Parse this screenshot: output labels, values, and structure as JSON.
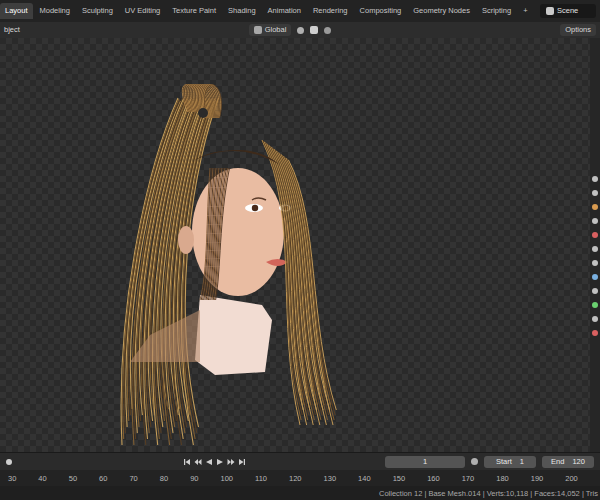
{
  "top_bar": {
    "tabs": [
      {
        "label": "Layout",
        "selected": true
      },
      {
        "label": "Modeling",
        "selected": false
      },
      {
        "label": "Sculpting",
        "selected": false
      },
      {
        "label": "UV Editing",
        "selected": false
      },
      {
        "label": "Texture Paint",
        "selected": false
      },
      {
        "label": "Shading",
        "selected": false
      },
      {
        "label": "Animation",
        "selected": false
      },
      {
        "label": "Rendering",
        "selected": false
      },
      {
        "label": "Compositing",
        "selected": false
      },
      {
        "label": "Geometry Nodes",
        "selected": false
      },
      {
        "label": "Scripting",
        "selected": false
      }
    ],
    "add_tab": "+",
    "scene": "Scene"
  },
  "header": {
    "mode": "bject",
    "orientation": "Global",
    "options": "Options"
  },
  "timeline": {
    "frame": "1",
    "start_label": "Start",
    "start": "1",
    "end_label": "End",
    "end": "120",
    "ruler": [
      "30",
      "40",
      "50",
      "60",
      "70",
      "80",
      "90",
      "100",
      "110",
      "120",
      "130",
      "140",
      "150",
      "160",
      "170",
      "180",
      "190",
      "200"
    ]
  },
  "status_bar": {
    "text": "Collection 12 | Base Mesh.014 | Verts:10,118 | Faces:14,052 | Tris"
  }
}
